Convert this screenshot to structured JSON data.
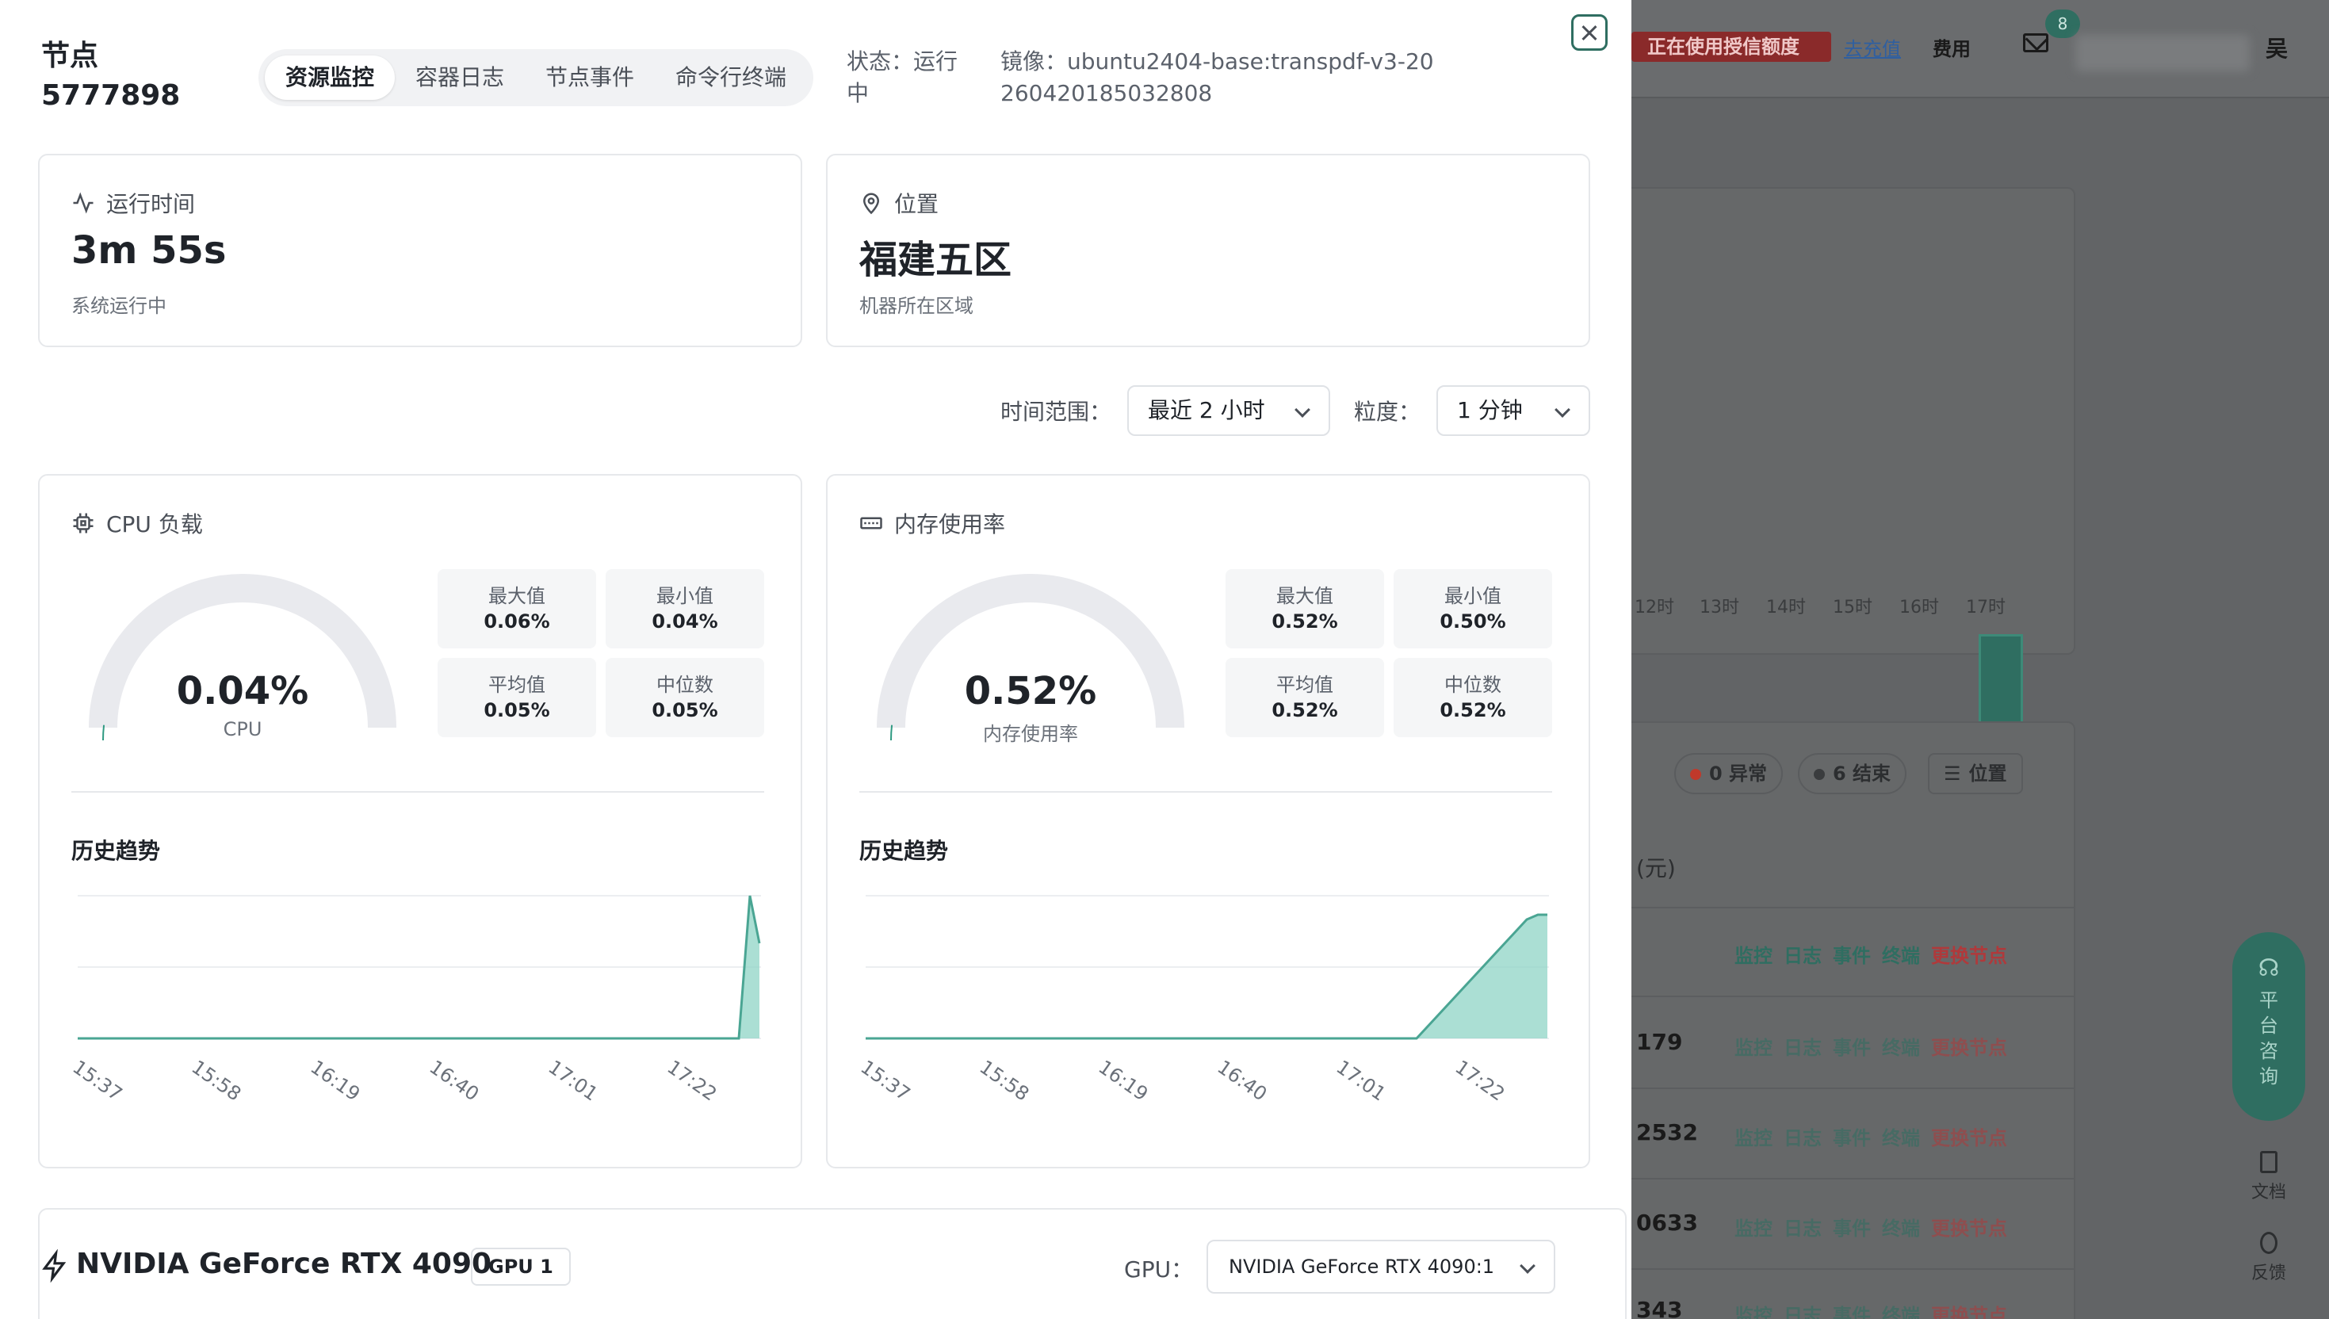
{
  "node": {
    "label": "节点",
    "id": "5777898"
  },
  "tabs": [
    "资源监控",
    "容器日志",
    "节点事件",
    "命令行终端"
  ],
  "status": "状态：运行中",
  "image": "镜像：ubuntu2404-base:transpdf-v3-20260420185032808",
  "uptime": {
    "title": "运行时间",
    "value": "3m 55s",
    "sub": "系统运行中"
  },
  "location": {
    "title": "位置",
    "value": "福建五区",
    "sub": "机器所在区域"
  },
  "filters": {
    "range_label": "时间范围：",
    "range_value": "最近 2 小时",
    "granularity_label": "粒度：",
    "granularity_value": "1 分钟"
  },
  "cpu": {
    "title": "CPU 负载",
    "value": "0.04%",
    "label": "CPU",
    "level": 0.04,
    "stats": [
      {
        "k": "最大值",
        "v": "0.06%"
      },
      {
        "k": "最小值",
        "v": "0.04%"
      },
      {
        "k": "平均值",
        "v": "0.05%"
      },
      {
        "k": "中位数",
        "v": "0.05%"
      }
    ],
    "history_title": "历史趋势"
  },
  "memory": {
    "title": "内存使用率",
    "value": "0.52%",
    "label": "内存使用率",
    "level": 0.52,
    "stats": [
      {
        "k": "最大值",
        "v": "0.52%"
      },
      {
        "k": "最小值",
        "v": "0.50%"
      },
      {
        "k": "平均值",
        "v": "0.52%"
      },
      {
        "k": "中位数",
        "v": "0.52%"
      }
    ],
    "history_title": "历史趋势"
  },
  "chart_data": [
    {
      "type": "area",
      "x": [
        "15:37",
        "15:58",
        "16:19",
        "16:40",
        "17:01",
        "17:22"
      ],
      "series": [
        {
          "values": [
            0,
            0,
            0,
            0,
            0,
            0,
            0.06,
            0.04
          ]
        }
      ],
      "ylim": [
        0,
        0.06
      ],
      "grid": true
    },
    {
      "type": "area",
      "x": [
        "15:37",
        "15:58",
        "16:19",
        "16:40",
        "17:01",
        "17:22"
      ],
      "series": [
        {
          "values": [
            0,
            0,
            0,
            0,
            0,
            0,
            0.5,
            0.52,
            0.52
          ]
        }
      ],
      "ylim": [
        0,
        0.6
      ],
      "grid": true
    }
  ],
  "gpu": {
    "name": "NVIDIA GeForce RTX 4090",
    "tag": "GPU 1",
    "label": "GPU：",
    "selected": "NVIDIA GeForce RTX 4090:1"
  },
  "background": {
    "alert": "正在使用授信额度",
    "recharge": "去充值",
    "fee": "费用",
    "badge": "8",
    "user": "吴",
    "xticks": [
      "12时",
      "13时",
      "14时",
      "15时",
      "16时",
      "17时"
    ],
    "pill_abnormal": "0 异常",
    "pill_ended": "6 结束",
    "location_btn": "位置",
    "unit": "(元)",
    "actions": [
      "监控",
      "日志",
      "事件",
      "终端",
      "更换节点"
    ],
    "cells": [
      "179",
      "2532",
      "0633",
      "343"
    ],
    "consult": "平台咨询",
    "docs": "文档",
    "feedback": "反馈"
  },
  "colors": {
    "accent": "#2f6e61",
    "area": "#8fd4c5",
    "line": "#4aa593",
    "gauge_track": "#e9eaee",
    "danger": "#c0392b"
  }
}
